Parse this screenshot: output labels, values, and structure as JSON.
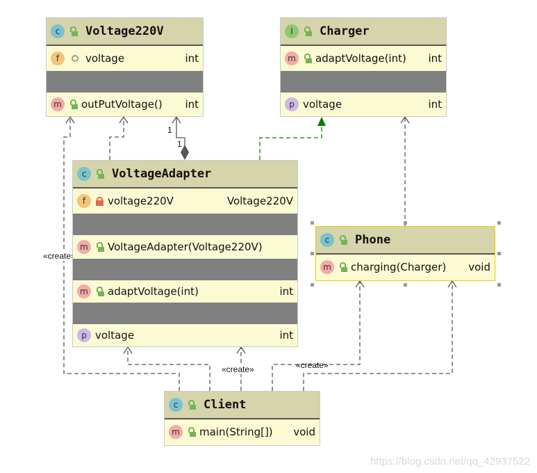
{
  "classes": {
    "voltage220v": {
      "kind": "C",
      "name": "Voltage220V",
      "field": {
        "name": "voltage",
        "type": "int"
      },
      "method": {
        "name": "outPutVoltage()",
        "type": "int"
      }
    },
    "charger": {
      "kind": "I",
      "name": "Charger",
      "method": {
        "name": "adaptVoltage(int)",
        "type": "int"
      },
      "property": {
        "name": "voltage",
        "type": "int"
      }
    },
    "adapter": {
      "kind": "C",
      "name": "VoltageAdapter",
      "field": {
        "name": "voltage220V",
        "type": "Voltage220V"
      },
      "constructor": {
        "name": "VoltageAdapter(Voltage220V)"
      },
      "method": {
        "name": "adaptVoltage(int)",
        "type": "int"
      },
      "property": {
        "name": "voltage",
        "type": "int"
      }
    },
    "phone": {
      "kind": "C",
      "name": "Phone",
      "method": {
        "name": "charging(Charger)",
        "type": "void"
      }
    },
    "client": {
      "kind": "C",
      "name": "Client",
      "method": {
        "name": "main(String[])",
        "type": "void"
      }
    }
  },
  "icons": {
    "f": "f",
    "m": "m",
    "p": "p"
  },
  "relations": {
    "create_label": "«create»",
    "multiplicity_source": "1",
    "multiplicity_target": "1"
  },
  "colors": {
    "header": "#d6d4aa",
    "body": "#fcfad2",
    "separator": "#808080",
    "implements": "#008000",
    "selection": "#f0c800"
  },
  "watermark": "https://blog.csdn.net/qq_42937522"
}
